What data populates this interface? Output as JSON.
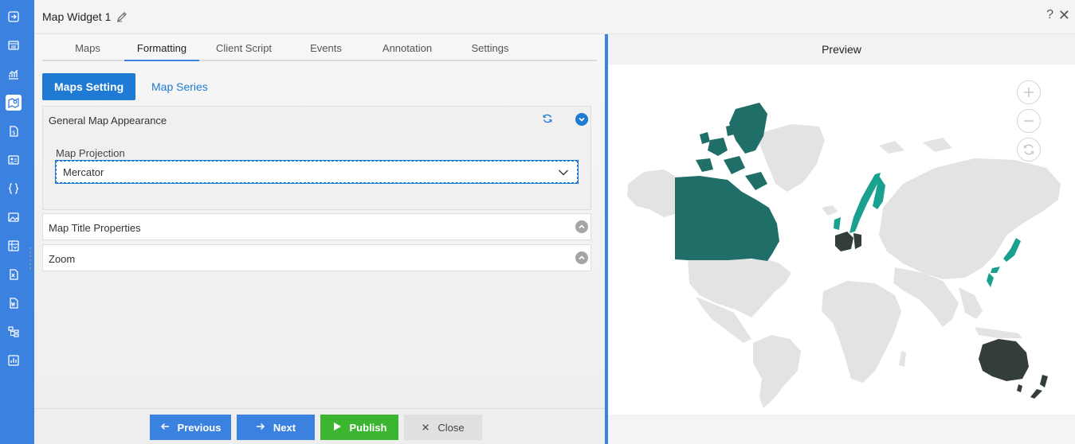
{
  "window": {
    "title": "Map Widget 1",
    "help": "?",
    "close": "✕"
  },
  "rail": {
    "items": [
      "enter-icon",
      "table-icon",
      "chart-icon",
      "map-icon",
      "dollar-doc-icon",
      "id-card-icon",
      "braces-icon",
      "image-icon",
      "pivot-icon",
      "excel-icon",
      "word-icon",
      "tree-icon",
      "bar-chart-icon"
    ],
    "active_index": 3
  },
  "tabs": [
    {
      "label": "Maps"
    },
    {
      "label": "Formatting"
    },
    {
      "label": "Client Script"
    },
    {
      "label": "Events"
    },
    {
      "label": "Annotation"
    },
    {
      "label": "Settings"
    }
  ],
  "active_tab": "Formatting",
  "subtabs": {
    "active": "Maps Setting",
    "other": "Map Series"
  },
  "sections": {
    "general": "General Map Appearance",
    "projection_label": "Map Projection",
    "projection_value": "Mercator",
    "title_props": "Map Title Properties",
    "zoom": "Zoom"
  },
  "buttons": {
    "previous": "Previous",
    "next": "Next",
    "publish": "Publish",
    "close": "Close"
  },
  "preview": {
    "title": "Preview"
  },
  "colors": {
    "accent": "#3b82e0",
    "primary_button": "#1f7ad3",
    "publish": "#3cb531",
    "map_land": "#e3e3e3",
    "map_teal_dark": "#1f6e68",
    "map_teal": "#1aa08f",
    "map_dark": "#333d3c"
  }
}
